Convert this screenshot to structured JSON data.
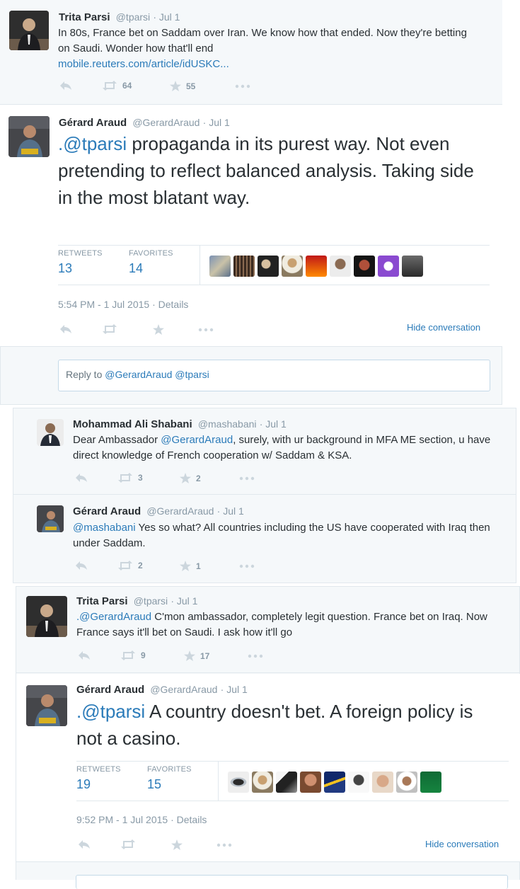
{
  "tweet1": {
    "name": "Trita Parsi",
    "handle": "@tparsi",
    "time": "· Jul 1",
    "text": "In 80s, France bet on Saddam over Iran. We know how that ended. Now they're betting on Saudi. Wonder how that'll end",
    "link": "mobile.reuters.com/article/idUSKC...",
    "retweets": "64",
    "favorites": "55"
  },
  "tweet2": {
    "name": "Gérard Araud",
    "handle": "@GerardAraud",
    "time": "· Jul 1",
    "mention": ".@tparsi",
    "text": " propaganda in its purest way. Not even pretending to reflect balanced analysis. Taking side in the most blatant way.",
    "retweets_label": "RETWEETS",
    "retweets": "13",
    "favorites_label": "FAVORITES",
    "favorites": "14",
    "timestamp": "5:54 PM - 1 Jul 2015",
    "details": "· Details",
    "hide": "Hide conversation",
    "reply_prefix": "Reply to ",
    "reply_mentions": "@GerardAraud @tparsi"
  },
  "reply1": {
    "name": "Mohammad Ali Shabani",
    "handle": "@mashabani",
    "time": "· Jul 1",
    "pre": "Dear Ambassador ",
    "mention": "@GerardAraud",
    "text": ", surely, with ur background in MFA ME section, u have direct knowledge of French cooperation w/ Saddam & KSA.",
    "retweets": "3",
    "favorites": "2"
  },
  "reply2": {
    "name": "Gérard Araud",
    "handle": "@GerardAraud",
    "time": "· Jul 1",
    "mention": "@mashabani",
    "text": " Yes so what? All countries including the US have cooperated with Iraq then under Saddam.",
    "retweets": "2",
    "favorites": "1"
  },
  "tweet3": {
    "name": "Trita Parsi",
    "handle": "@tparsi",
    "time": "· Jul 1",
    "mention": ".@GerardAraud",
    "text": " C'mon ambassador, completely legit question. France bet on Iraq. Now France says it'll bet on Saudi. I ask how it'll go",
    "retweets": "9",
    "favorites": "17"
  },
  "tweet4": {
    "name": "Gérard Araud",
    "handle": "@GerardAraud",
    "time": "· Jul 1",
    "mention": ".@tparsi",
    "text": " A country doesn't bet. A foreign policy is not a casino.",
    "retweets_label": "RETWEETS",
    "retweets": "19",
    "favorites_label": "FAVORITES",
    "favorites": "15",
    "timestamp": "9:52 PM - 1 Jul 2015",
    "details": "· Details",
    "hide": "Hide conversation"
  },
  "colors": {
    "link": "#2b7bb9",
    "muted": "#8899a6",
    "panel_bg": "#f5f8fa"
  },
  "icons": [
    "reply-icon",
    "retweet-icon",
    "favorite-icon",
    "more-icon"
  ]
}
